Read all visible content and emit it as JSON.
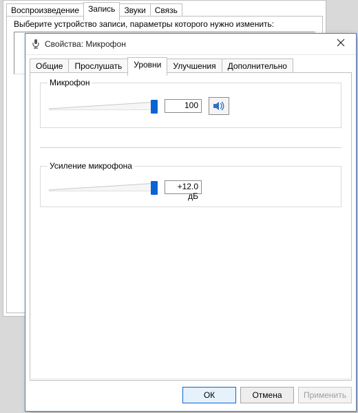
{
  "bg_tabs": {
    "playback": "Воспроизведение",
    "recording": "Запись",
    "sounds": "Звуки",
    "comm": "Связь"
  },
  "bg_instruction": "Выберите устройство записи, параметры которого нужно изменить:",
  "dialog": {
    "title": "Свойства: Микрофон",
    "tabs": {
      "general": "Общие",
      "listen": "Прослушать",
      "levels": "Уровни",
      "enhance": "Улучшения",
      "advanced": "Дополнительно"
    },
    "groups": {
      "mic": {
        "legend": "Микрофон",
        "value": "100",
        "thumb_pct": 100
      },
      "boost": {
        "legend": "Усиление микрофона",
        "value": "+12.0 дБ",
        "thumb_pct": 100
      }
    },
    "buttons": {
      "ok": "ОК",
      "cancel": "Отмена",
      "apply": "Применить"
    }
  }
}
